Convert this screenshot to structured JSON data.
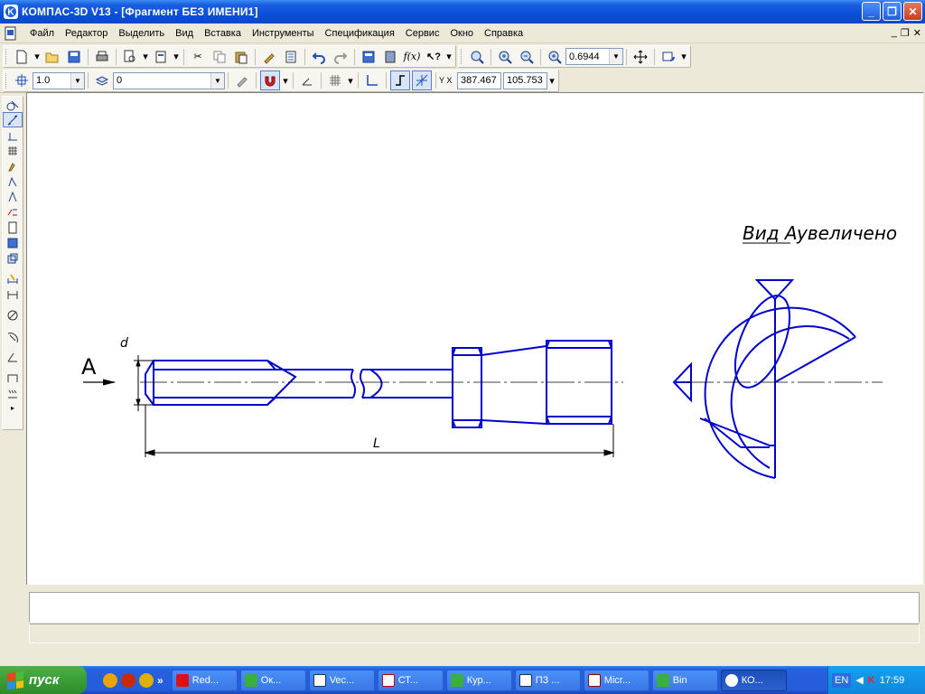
{
  "window": {
    "title": "КОМПАС-3D V13 - [Фрагмент БЕЗ ИМЕНИ1]",
    "buttons": [
      "_",
      "❐",
      "✕"
    ]
  },
  "menu": {
    "items": [
      "Файл",
      "Редактор",
      "Выделить",
      "Вид",
      "Вставка",
      "Инструменты",
      "Спецификация",
      "Сервис",
      "Окно",
      "Справка"
    ],
    "mdi_buttons": [
      "_",
      "❐",
      "✕"
    ]
  },
  "toolbar": {
    "zoom_value": "0.6944",
    "step_value": "1.0",
    "layer_value": "0",
    "coord_x": "387.467",
    "coord_y": "105.753",
    "coord_label": "Y X"
  },
  "drawing": {
    "view_label": "Вид А",
    "view_suffix": "увеличено",
    "arrow_label": "А",
    "dim_d": "d",
    "dim_L": "L",
    "line_color": "#0000cc"
  },
  "taskbar": {
    "start_label": "пуск",
    "tasks": [
      "Red...",
      "Ок...",
      "Vec...",
      "СТ...",
      "Кур...",
      "ПЗ ...",
      "Micr...",
      "Bin",
      "КО..."
    ],
    "language": "EN",
    "clock": "17:59"
  }
}
